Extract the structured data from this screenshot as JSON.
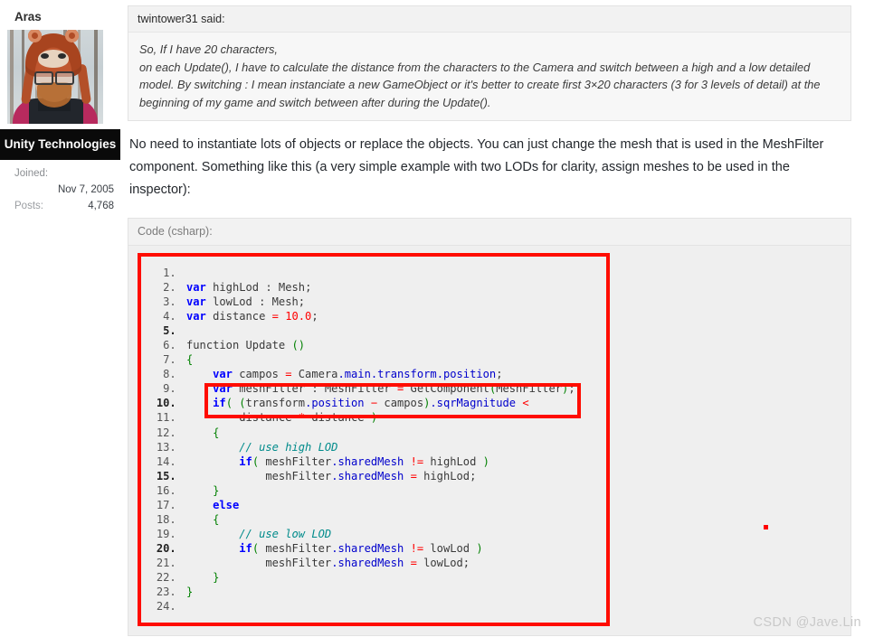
{
  "author": {
    "name": "Aras",
    "avatar_alt": "avatar-photo",
    "badge": "Unity Technologies",
    "joined_label": "Joined:",
    "joined_value": "Nov 7, 2005",
    "posts_label": "Posts:",
    "posts_value": "4,768"
  },
  "quote": {
    "header": "twintower31 said:",
    "line1": "So, If I have 20 characters,",
    "line2": "on each Update(), I have to calculate the distance from the characters to the Camera and switch between a high and a low detailed",
    "line3": "model. By switching : I mean instanciate a new GameObject or it's better to create first 3×20 characters (3 for 3 levels of detail) at the",
    "line4": "beginning of my game and switch between after during the Update()."
  },
  "reply": {
    "text": "No need to instantiate lots of objects or replace the objects. You can just change the mesh that is used in the MeshFilter component. Something like this (a very simple example with two LODs for clarity, assign meshes to be used in the inspector):"
  },
  "code_block": {
    "header": "Code (csharp):",
    "language": "csharp",
    "highlight_color": "#ff0c00",
    "bold_line_numbers": [
      5,
      10,
      15,
      20
    ],
    "lines": [
      {
        "n": 1,
        "tokens": []
      },
      {
        "n": 2,
        "tokens": [
          {
            "t": "kw",
            "v": "var"
          },
          {
            "t": "plain",
            "v": " highLod : Mesh"
          },
          {
            "t": "plain",
            "v": ";"
          }
        ]
      },
      {
        "n": 3,
        "tokens": [
          {
            "t": "kw",
            "v": "var"
          },
          {
            "t": "plain",
            "v": " lowLod : Mesh"
          },
          {
            "t": "plain",
            "v": ";"
          }
        ]
      },
      {
        "n": 4,
        "tokens": [
          {
            "t": "kw",
            "v": "var"
          },
          {
            "t": "plain",
            "v": " distance "
          },
          {
            "t": "op",
            "v": "="
          },
          {
            "t": "plain",
            "v": " "
          },
          {
            "t": "num",
            "v": "10.0"
          },
          {
            "t": "plain",
            "v": ";"
          }
        ]
      },
      {
        "n": 5,
        "tokens": []
      },
      {
        "n": 6,
        "tokens": [
          {
            "t": "plain",
            "v": "function Update "
          },
          {
            "t": "brc",
            "v": "()"
          }
        ]
      },
      {
        "n": 7,
        "tokens": [
          {
            "t": "brc",
            "v": "{"
          }
        ]
      },
      {
        "n": 8,
        "tokens": [
          {
            "t": "plain",
            "v": "    "
          },
          {
            "t": "kw",
            "v": "var"
          },
          {
            "t": "plain",
            "v": " campos "
          },
          {
            "t": "op",
            "v": "="
          },
          {
            "t": "plain",
            "v": " Camera"
          },
          {
            "t": "prop",
            "v": ".main"
          },
          {
            "t": "prop",
            "v": ".transform"
          },
          {
            "t": "prop",
            "v": ".position"
          },
          {
            "t": "plain",
            "v": ";"
          }
        ]
      },
      {
        "n": 9,
        "tokens": [
          {
            "t": "plain",
            "v": "    "
          },
          {
            "t": "kw",
            "v": "var"
          },
          {
            "t": "plain",
            "v": " meshFilter : MeshFilter "
          },
          {
            "t": "op",
            "v": "="
          },
          {
            "t": "plain",
            "v": " GetComponent"
          },
          {
            "t": "brc",
            "v": "("
          },
          {
            "t": "plain",
            "v": "MeshFilter"
          },
          {
            "t": "brc",
            "v": ")"
          },
          {
            "t": "plain",
            "v": ";"
          }
        ]
      },
      {
        "n": 10,
        "tokens": [
          {
            "t": "plain",
            "v": "    "
          },
          {
            "t": "kw",
            "v": "if"
          },
          {
            "t": "brc",
            "v": "("
          },
          {
            "t": "plain",
            "v": " "
          },
          {
            "t": "brc",
            "v": "("
          },
          {
            "t": "plain",
            "v": "transform"
          },
          {
            "t": "prop",
            "v": ".position"
          },
          {
            "t": "plain",
            "v": " "
          },
          {
            "t": "op",
            "v": "−"
          },
          {
            "t": "plain",
            "v": " campos"
          },
          {
            "t": "brc",
            "v": ")"
          },
          {
            "t": "prop",
            "v": ".sqrMagnitude"
          },
          {
            "t": "plain",
            "v": " "
          },
          {
            "t": "op",
            "v": "<"
          }
        ]
      },
      {
        "n": 11,
        "tokens": [
          {
            "t": "plain",
            "v": "        distance "
          },
          {
            "t": "op",
            "v": "*"
          },
          {
            "t": "plain",
            "v": " distance "
          },
          {
            "t": "brc",
            "v": ")"
          }
        ]
      },
      {
        "n": 12,
        "tokens": [
          {
            "t": "plain",
            "v": "    "
          },
          {
            "t": "brc",
            "v": "{"
          }
        ]
      },
      {
        "n": 13,
        "tokens": [
          {
            "t": "plain",
            "v": "        "
          },
          {
            "t": "cmt",
            "v": "// use high LOD"
          }
        ]
      },
      {
        "n": 14,
        "tokens": [
          {
            "t": "plain",
            "v": "        "
          },
          {
            "t": "kw",
            "v": "if"
          },
          {
            "t": "brc",
            "v": "("
          },
          {
            "t": "plain",
            "v": " meshFilter"
          },
          {
            "t": "prop",
            "v": ".sharedMesh"
          },
          {
            "t": "plain",
            "v": " "
          },
          {
            "t": "op",
            "v": "!="
          },
          {
            "t": "plain",
            "v": " highLod "
          },
          {
            "t": "brc",
            "v": ")"
          }
        ]
      },
      {
        "n": 15,
        "tokens": [
          {
            "t": "plain",
            "v": "            meshFilter"
          },
          {
            "t": "prop",
            "v": ".sharedMesh"
          },
          {
            "t": "plain",
            "v": " "
          },
          {
            "t": "op",
            "v": "="
          },
          {
            "t": "plain",
            "v": " highLod;"
          }
        ]
      },
      {
        "n": 16,
        "tokens": [
          {
            "t": "plain",
            "v": "    "
          },
          {
            "t": "brc",
            "v": "}"
          }
        ]
      },
      {
        "n": 17,
        "tokens": [
          {
            "t": "plain",
            "v": "    "
          },
          {
            "t": "kw",
            "v": "else"
          }
        ]
      },
      {
        "n": 18,
        "tokens": [
          {
            "t": "plain",
            "v": "    "
          },
          {
            "t": "brc",
            "v": "{"
          }
        ]
      },
      {
        "n": 19,
        "tokens": [
          {
            "t": "plain",
            "v": "        "
          },
          {
            "t": "cmt",
            "v": "// use low LOD"
          }
        ]
      },
      {
        "n": 20,
        "tokens": [
          {
            "t": "plain",
            "v": "        "
          },
          {
            "t": "kw",
            "v": "if"
          },
          {
            "t": "brc",
            "v": "("
          },
          {
            "t": "plain",
            "v": " meshFilter"
          },
          {
            "t": "prop",
            "v": ".sharedMesh"
          },
          {
            "t": "plain",
            "v": " "
          },
          {
            "t": "op",
            "v": "!="
          },
          {
            "t": "plain",
            "v": " lowLod "
          },
          {
            "t": "brc",
            "v": ")"
          }
        ]
      },
      {
        "n": 21,
        "tokens": [
          {
            "t": "plain",
            "v": "            meshFilter"
          },
          {
            "t": "prop",
            "v": ".sharedMesh"
          },
          {
            "t": "plain",
            "v": " "
          },
          {
            "t": "op",
            "v": "="
          },
          {
            "t": "plain",
            "v": " lowLod;"
          }
        ]
      },
      {
        "n": 22,
        "tokens": [
          {
            "t": "plain",
            "v": "    "
          },
          {
            "t": "brc",
            "v": "}"
          }
        ]
      },
      {
        "n": 23,
        "tokens": [
          {
            "t": "brc",
            "v": "}"
          }
        ]
      },
      {
        "n": 24,
        "tokens": []
      }
    ]
  },
  "annotations": {
    "red_dot": "red-dot-marker"
  },
  "watermark": "CSDN @Jave.Lin"
}
